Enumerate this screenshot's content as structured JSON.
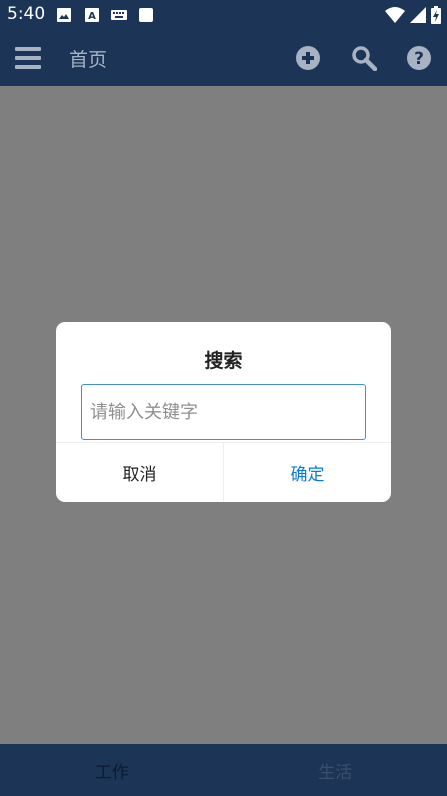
{
  "status_bar": {
    "time": "5:40",
    "icons": [
      "image-icon",
      "keyboard-a-icon",
      "keyboard-icon",
      "square-icon",
      "wifi-icon",
      "signal-icon",
      "battery-charging-icon"
    ]
  },
  "app_bar": {
    "title": "首页",
    "icons": [
      "menu-icon",
      "add-circle-icon",
      "search-icon",
      "help-icon"
    ]
  },
  "dialog": {
    "title": "搜索",
    "input_placeholder": "请输入关键字",
    "input_value": "",
    "cancel_label": "取消",
    "confirm_label": "确定"
  },
  "bottom_nav": {
    "tabs": [
      {
        "label": "工作"
      },
      {
        "label": "生活"
      }
    ]
  },
  "colors": {
    "primary": "#1c3557",
    "accent": "#0a7ae0",
    "input_border": "#3d8ee6"
  }
}
